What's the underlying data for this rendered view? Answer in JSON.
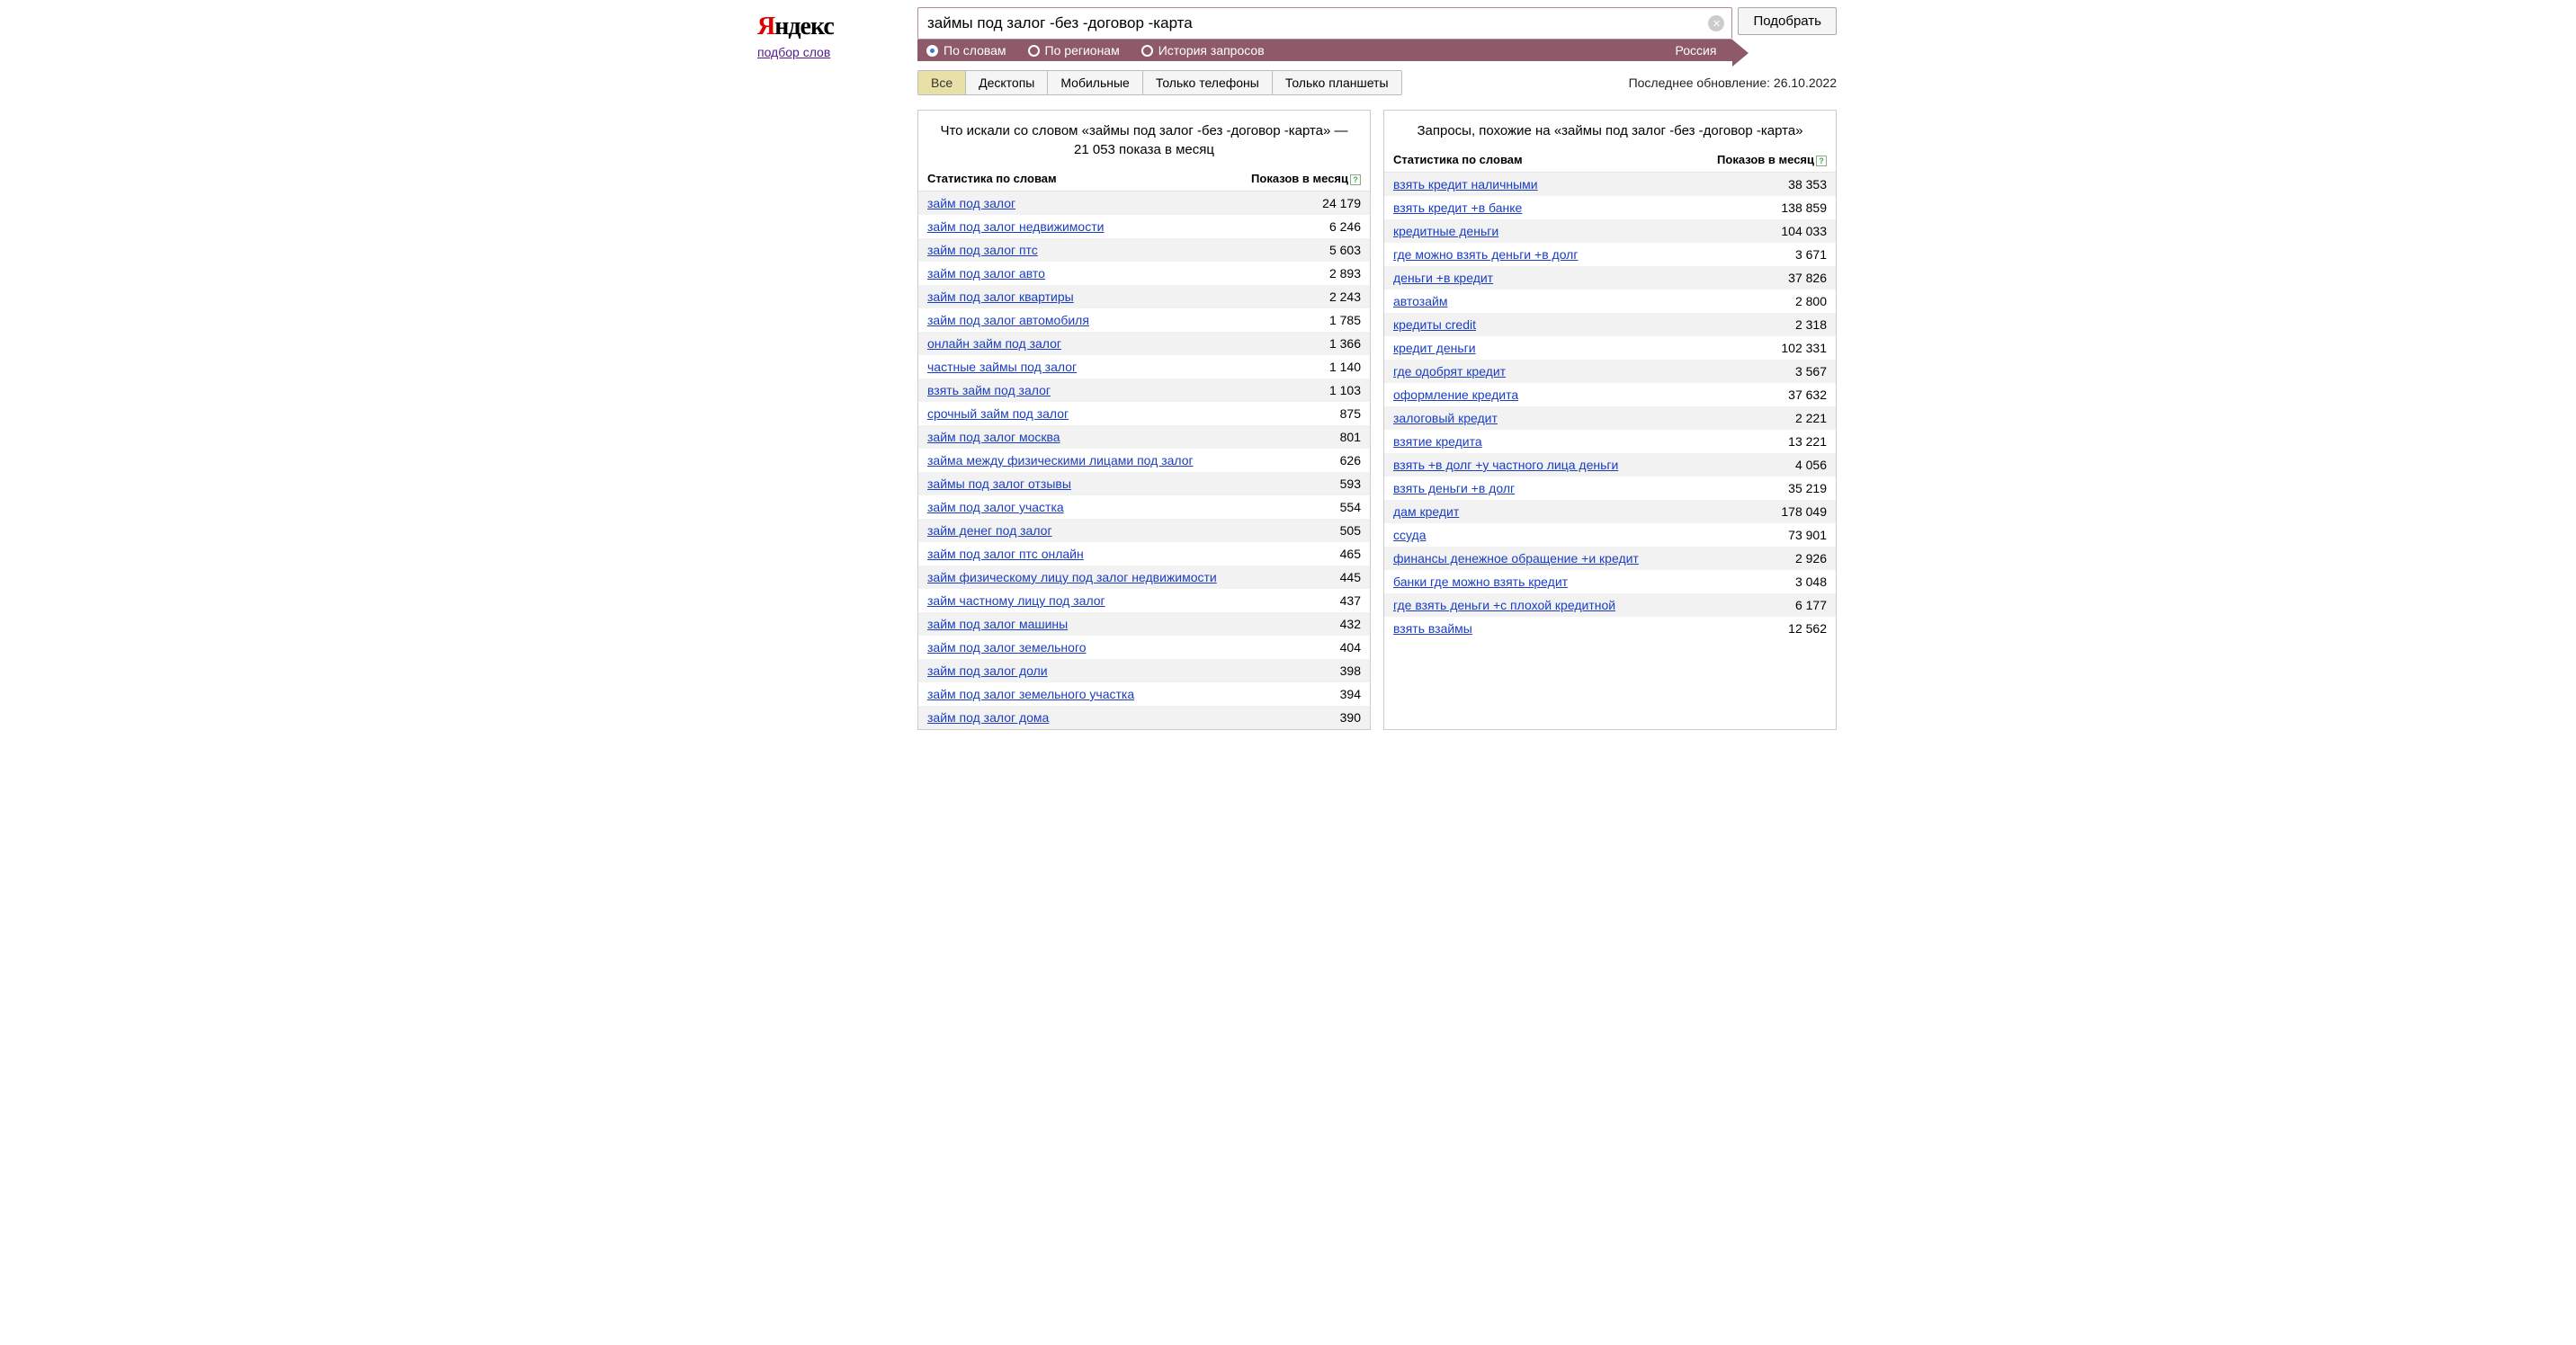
{
  "logo": {
    "ya": "Я",
    "ndex": "ндекс"
  },
  "sub_link": "подбор слов",
  "search": {
    "value": "займы под залог -без -договор -карта",
    "button": "Подобрать"
  },
  "mode_tabs": {
    "by_words": "По словам",
    "by_regions": "По регионам",
    "history": "История запросов"
  },
  "region": "Россия",
  "device_tabs": {
    "all": "Все",
    "desktops": "Десктопы",
    "mobile": "Мобильные",
    "phones": "Только телефоны",
    "tablets": "Только планшеты"
  },
  "updated": "Последнее обновление: 26.10.2022",
  "left_panel": {
    "title": "Что искали со словом «займы под залог -без -договор -карта» — 21 053 показа в месяц",
    "col1": "Статистика по словам",
    "col2": "Показов в месяц",
    "rows": [
      {
        "q": "займ под залог",
        "n": "24 179"
      },
      {
        "q": "займ под залог недвижимости",
        "n": "6 246"
      },
      {
        "q": "займ под залог птс",
        "n": "5 603"
      },
      {
        "q": "займ под залог авто",
        "n": "2 893"
      },
      {
        "q": "займ под залог квартиры",
        "n": "2 243"
      },
      {
        "q": "займ под залог автомобиля",
        "n": "1 785"
      },
      {
        "q": "онлайн займ под залог",
        "n": "1 366"
      },
      {
        "q": "частные займы под залог",
        "n": "1 140"
      },
      {
        "q": "взять займ под залог",
        "n": "1 103"
      },
      {
        "q": "срочный займ под залог",
        "n": "875"
      },
      {
        "q": "займ под залог москва",
        "n": "801"
      },
      {
        "q": "займа между физическими лицами под залог",
        "n": "626"
      },
      {
        "q": "займы под залог отзывы",
        "n": "593"
      },
      {
        "q": "займ под залог участка",
        "n": "554"
      },
      {
        "q": "займ денег под залог",
        "n": "505"
      },
      {
        "q": "займ под залог птс онлайн",
        "n": "465"
      },
      {
        "q": "займ физическому лицу под залог недвижимости",
        "n": "445"
      },
      {
        "q": "займ частному лицу под залог",
        "n": "437"
      },
      {
        "q": "займ под залог машины",
        "n": "432"
      },
      {
        "q": "займ под залог земельного",
        "n": "404"
      },
      {
        "q": "займ под залог доли",
        "n": "398"
      },
      {
        "q": "займ под залог земельного участка",
        "n": "394"
      },
      {
        "q": "займ под залог дома",
        "n": "390"
      }
    ]
  },
  "right_panel": {
    "title": "Запросы, похожие на «займы под залог -без -договор -карта»",
    "col1": "Статистика по словам",
    "col2": "Показов в месяц",
    "rows": [
      {
        "q": "взять кредит наличными",
        "n": "38 353"
      },
      {
        "q": "взять кредит +в банке",
        "n": "138 859"
      },
      {
        "q": "кредитные деньги",
        "n": "104 033"
      },
      {
        "q": "где можно взять деньги +в долг",
        "n": "3 671"
      },
      {
        "q": "деньги +в кредит",
        "n": "37 826"
      },
      {
        "q": "автозайм",
        "n": "2 800"
      },
      {
        "q": "кредиты credit",
        "n": "2 318"
      },
      {
        "q": "кредит деньги",
        "n": "102 331"
      },
      {
        "q": "где одобрят кредит",
        "n": "3 567"
      },
      {
        "q": "оформление кредита",
        "n": "37 632"
      },
      {
        "q": "залоговый кредит",
        "n": "2 221"
      },
      {
        "q": "взятие кредита",
        "n": "13 221"
      },
      {
        "q": "взять +в долг +у частного лица деньги",
        "n": "4 056"
      },
      {
        "q": "взять деньги +в долг",
        "n": "35 219"
      },
      {
        "q": "дам кредит",
        "n": "178 049"
      },
      {
        "q": "ссуда",
        "n": "73 901"
      },
      {
        "q": "финансы денежное обращение +и кредит",
        "n": "2 926"
      },
      {
        "q": "банки где можно взять кредит",
        "n": "3 048"
      },
      {
        "q": "где взять деньги +с плохой кредитной",
        "n": "6 177"
      },
      {
        "q": "взять взаймы",
        "n": "12 562"
      }
    ]
  }
}
